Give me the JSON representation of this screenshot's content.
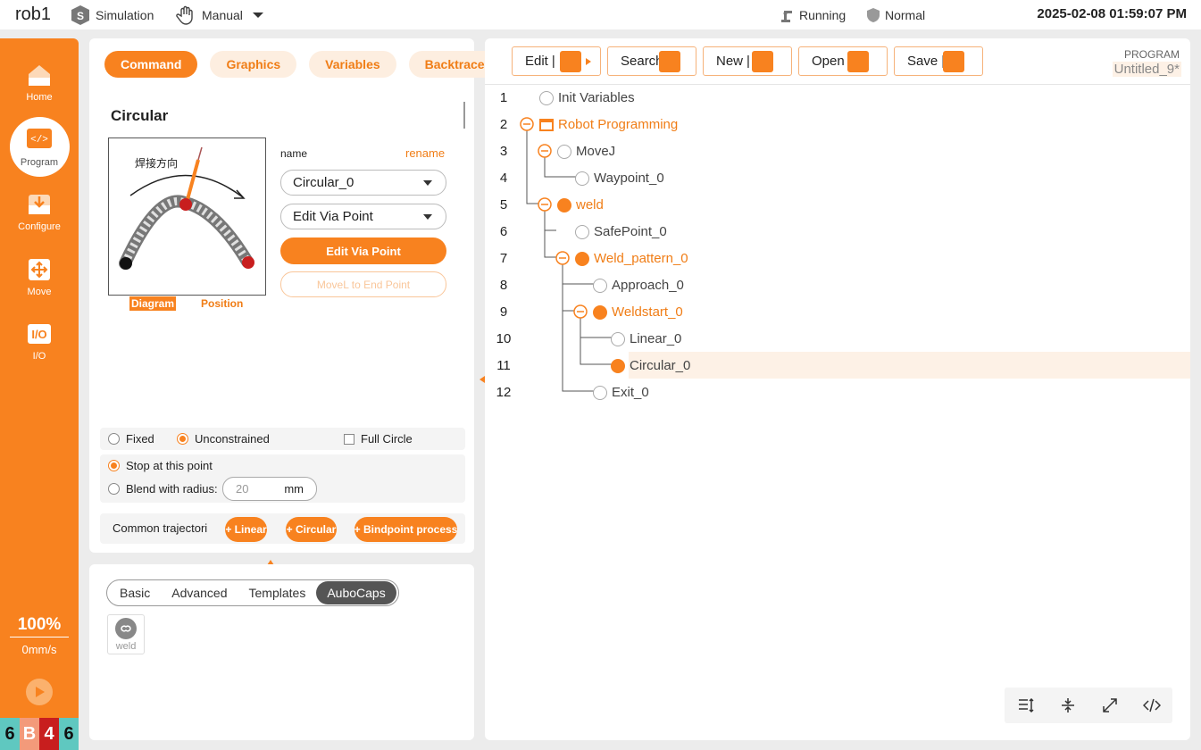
{
  "topbar": {
    "robot_name": "rob1",
    "mode": "Simulation",
    "control": "Manual",
    "run_state": "Running",
    "safety_state": "Normal",
    "datetime": "2025-02-08 01:59:07 PM"
  },
  "sidebar": {
    "items": [
      {
        "label": "Home",
        "icon": "home-icon"
      },
      {
        "label": "Program",
        "icon": "code-icon",
        "active": true
      },
      {
        "label": "Configure",
        "icon": "download-icon"
      },
      {
        "label": "Move",
        "icon": "move-arrows-icon"
      },
      {
        "label": "I/O",
        "icon": "io-icon"
      }
    ],
    "speed_percent": "100%",
    "speed_value": "0mm/s",
    "status_cells": [
      {
        "text": "6",
        "color": "#5fc8c0"
      },
      {
        "text": "B",
        "color": "#f39a7a"
      },
      {
        "text": "4",
        "color": "#c81e1e"
      },
      {
        "text": "6",
        "color": "#5fc8c0"
      }
    ]
  },
  "command_panel": {
    "tabs": [
      "Command",
      "Graphics",
      "Variables",
      "Backtrace"
    ],
    "title": "Circular",
    "diagram_text": "焊接方向",
    "diagram_tabs": [
      "Diagram",
      "Position"
    ],
    "name_label": "name",
    "rename_label": "rename",
    "name_select": "Circular_0",
    "mode_select": "Edit Via Point",
    "edit_via_point_btn": "Edit Via Point",
    "movel_btn": "MoveL to End Point",
    "option_fixed": "Fixed",
    "option_unconstrained": "Unconstrained",
    "option_full_circle": "Full Circle",
    "option_stop": "Stop at this point",
    "option_blend": "Blend with radius:",
    "blend_radius_placeholder": "20",
    "blend_unit": "mm",
    "common_label": "Common trajectori",
    "add_linear": "+ Linear",
    "add_circular": "+ Circular",
    "add_bindpoint": "+ Bindpoint process"
  },
  "library_panel": {
    "tabs": [
      "Basic",
      "Advanced",
      "Templates",
      "AuboCaps"
    ],
    "active_tab": "AuboCaps",
    "tile_label": "weld"
  },
  "program_panel": {
    "toolbar": [
      "Edit",
      "Search",
      "New",
      "Open",
      "Save"
    ],
    "program_label": "PROGRAM",
    "program_name": "Untitled_9*",
    "rows": [
      {
        "no": "1",
        "text": "Init Variables"
      },
      {
        "no": "2",
        "text": "Robot Programming"
      },
      {
        "no": "3",
        "text": "MoveJ"
      },
      {
        "no": "4",
        "text": "Waypoint_0"
      },
      {
        "no": "5",
        "text": "weld"
      },
      {
        "no": "6",
        "text": "SafePoint_0"
      },
      {
        "no": "7",
        "text": "Weld_pattern_0"
      },
      {
        "no": "8",
        "text": "Approach_0"
      },
      {
        "no": "9",
        "text": "Weldstart_0"
      },
      {
        "no": "10",
        "text": "Linear_0"
      },
      {
        "no": "11",
        "text": "Circular_0"
      },
      {
        "no": "12",
        "text": "Exit_0"
      }
    ]
  },
  "colors": {
    "accent": "#f8821f",
    "accent_light": "#fdeee0"
  }
}
